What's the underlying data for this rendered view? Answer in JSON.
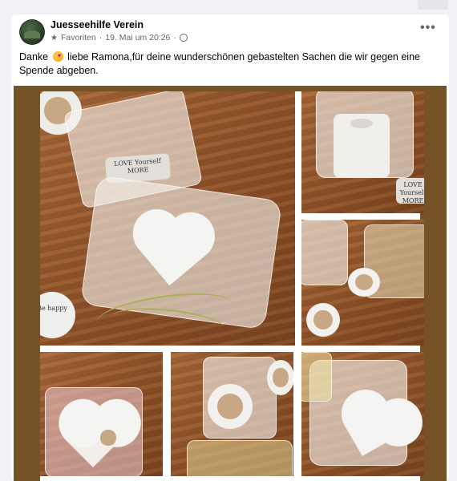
{
  "post": {
    "author": "Juesseehilfe Verein",
    "audience": "Favoriten",
    "separator": "·",
    "timestamp": "19. Mai um 20:26",
    "more_label": "•••",
    "text_before_emoji": "Danke",
    "emoji": "smiling-face-with-hearts",
    "text_after_emoji": " liebe Ramona,für deine wunderschönen gebastelten Sachen die wir gegen eine Spende abgeben."
  },
  "photos": {
    "tag_main": "LOVE Yourself MORE",
    "tag_small": "LOVE Yourself MORE",
    "tag_round": "Be happy"
  },
  "colors": {
    "frame_brown": "#765227",
    "card_bg": "#ffffff",
    "page_bg": "#f0f2f5"
  }
}
